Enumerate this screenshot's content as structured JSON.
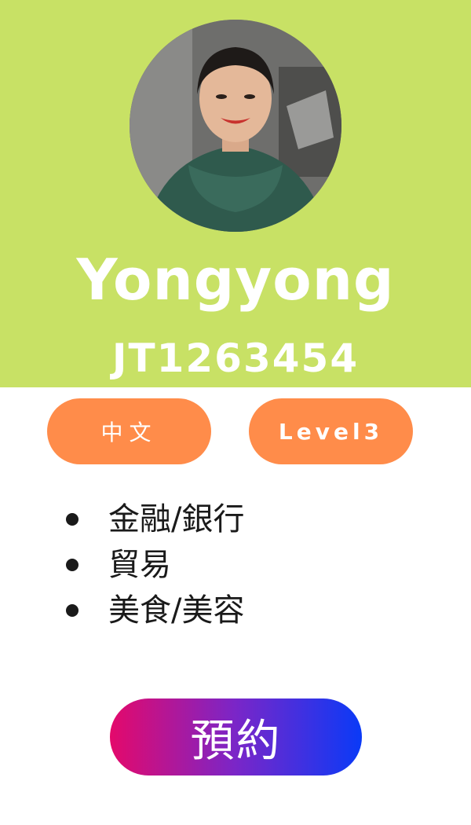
{
  "profile": {
    "name": "Yongyong",
    "code": "JT1263454",
    "avatar_icon": "profile-photo-icon"
  },
  "badges": {
    "language": "中文",
    "level": "Level3"
  },
  "skills": [
    {
      "label": "金融/銀行"
    },
    {
      "label": "貿易"
    },
    {
      "label": "美食/美容"
    }
  ],
  "actions": {
    "book_label": "預約"
  },
  "colors": {
    "header_bg": "#c8e165",
    "badge_bg": "#ff8c4a",
    "button_gradient_start": "#e4096b",
    "button_gradient_end": "#0a3af7"
  }
}
